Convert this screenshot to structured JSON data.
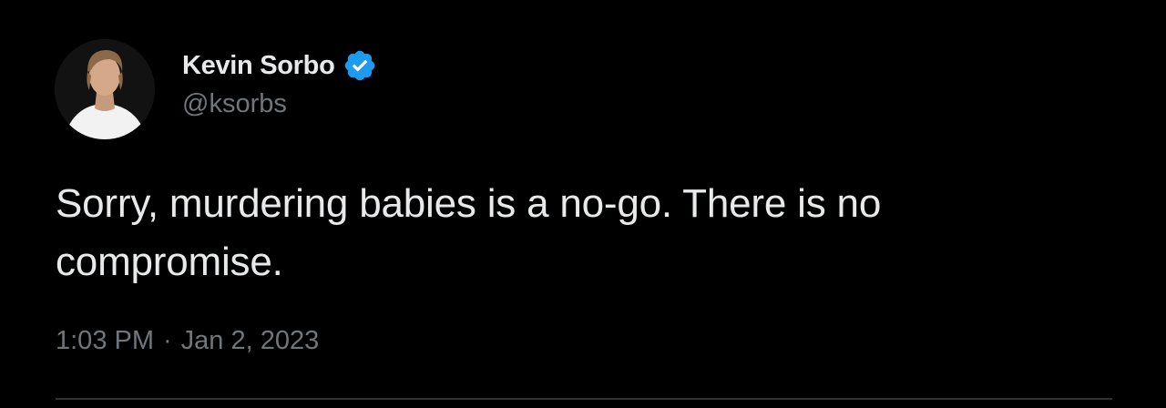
{
  "author": {
    "display_name": "Kevin Sorbo",
    "handle": "@ksorbs",
    "verified_icon": "verified-badge-icon",
    "verified_color": "#1d9bf0"
  },
  "tweet": {
    "line1": "Sorry, murdering babies is a no-go. There is no",
    "line2": "compromise.",
    "time": "1:03 PM",
    "separator": "·",
    "date": "Jan 2, 2023"
  },
  "colors": {
    "background": "#000000",
    "primary_text": "#e7e9ea",
    "secondary_text": "#71767b",
    "divider": "#2f3336"
  }
}
